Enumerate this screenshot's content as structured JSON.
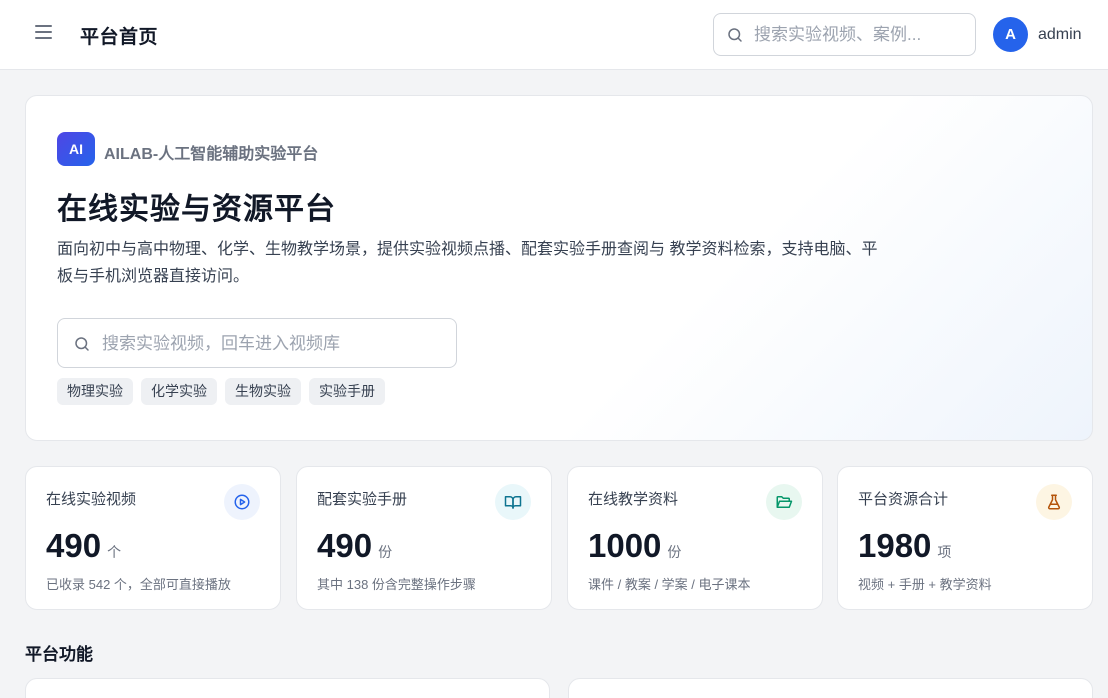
{
  "header": {
    "title": "平台首页",
    "search_placeholder": "搜索实验视频、案例...",
    "user": {
      "avatar_letter": "A",
      "name": "admin"
    }
  },
  "hero": {
    "badge": "AI",
    "brand": "AILAB-人工智能辅助实验平台",
    "title": "在线实验与资源平台",
    "description": "面向初中与高中物理、化学、生物教学场景，提供实验视频点播、配套实验手册查阅与 教学资料检索，支持电脑、平板与手机浏览器直接访问。",
    "search_placeholder": "搜索实验视频，回车进入视频库",
    "tags": [
      "物理实验",
      "化学实验",
      "生物实验",
      "实验手册"
    ]
  },
  "stats": [
    {
      "label": "在线实验视频",
      "value": "490",
      "unit": "个",
      "note": "已收录 542 个，全部可直接播放",
      "icon": "play-circle-icon",
      "color": "#2563eb",
      "bg": "#eef3fd"
    },
    {
      "label": "配套实验手册",
      "value": "490",
      "unit": "份",
      "note": "其中 138 份含完整操作步骤",
      "icon": "book-open-icon",
      "color": "#0e7490",
      "bg": "#e9f7fa"
    },
    {
      "label": "在线教学资料",
      "value": "1000",
      "unit": "份",
      "note": "课件 / 教案 / 学案 / 电子课本",
      "icon": "folder-open-icon",
      "color": "#059669",
      "bg": "#e8f7f0"
    },
    {
      "label": "平台资源合计",
      "value": "1980",
      "unit": "项",
      "note": "视频 + 手册 + 教学资料",
      "icon": "flask-icon",
      "color": "#b45309",
      "bg": "#fdf5e3"
    }
  ],
  "features": {
    "title": "平台功能"
  }
}
